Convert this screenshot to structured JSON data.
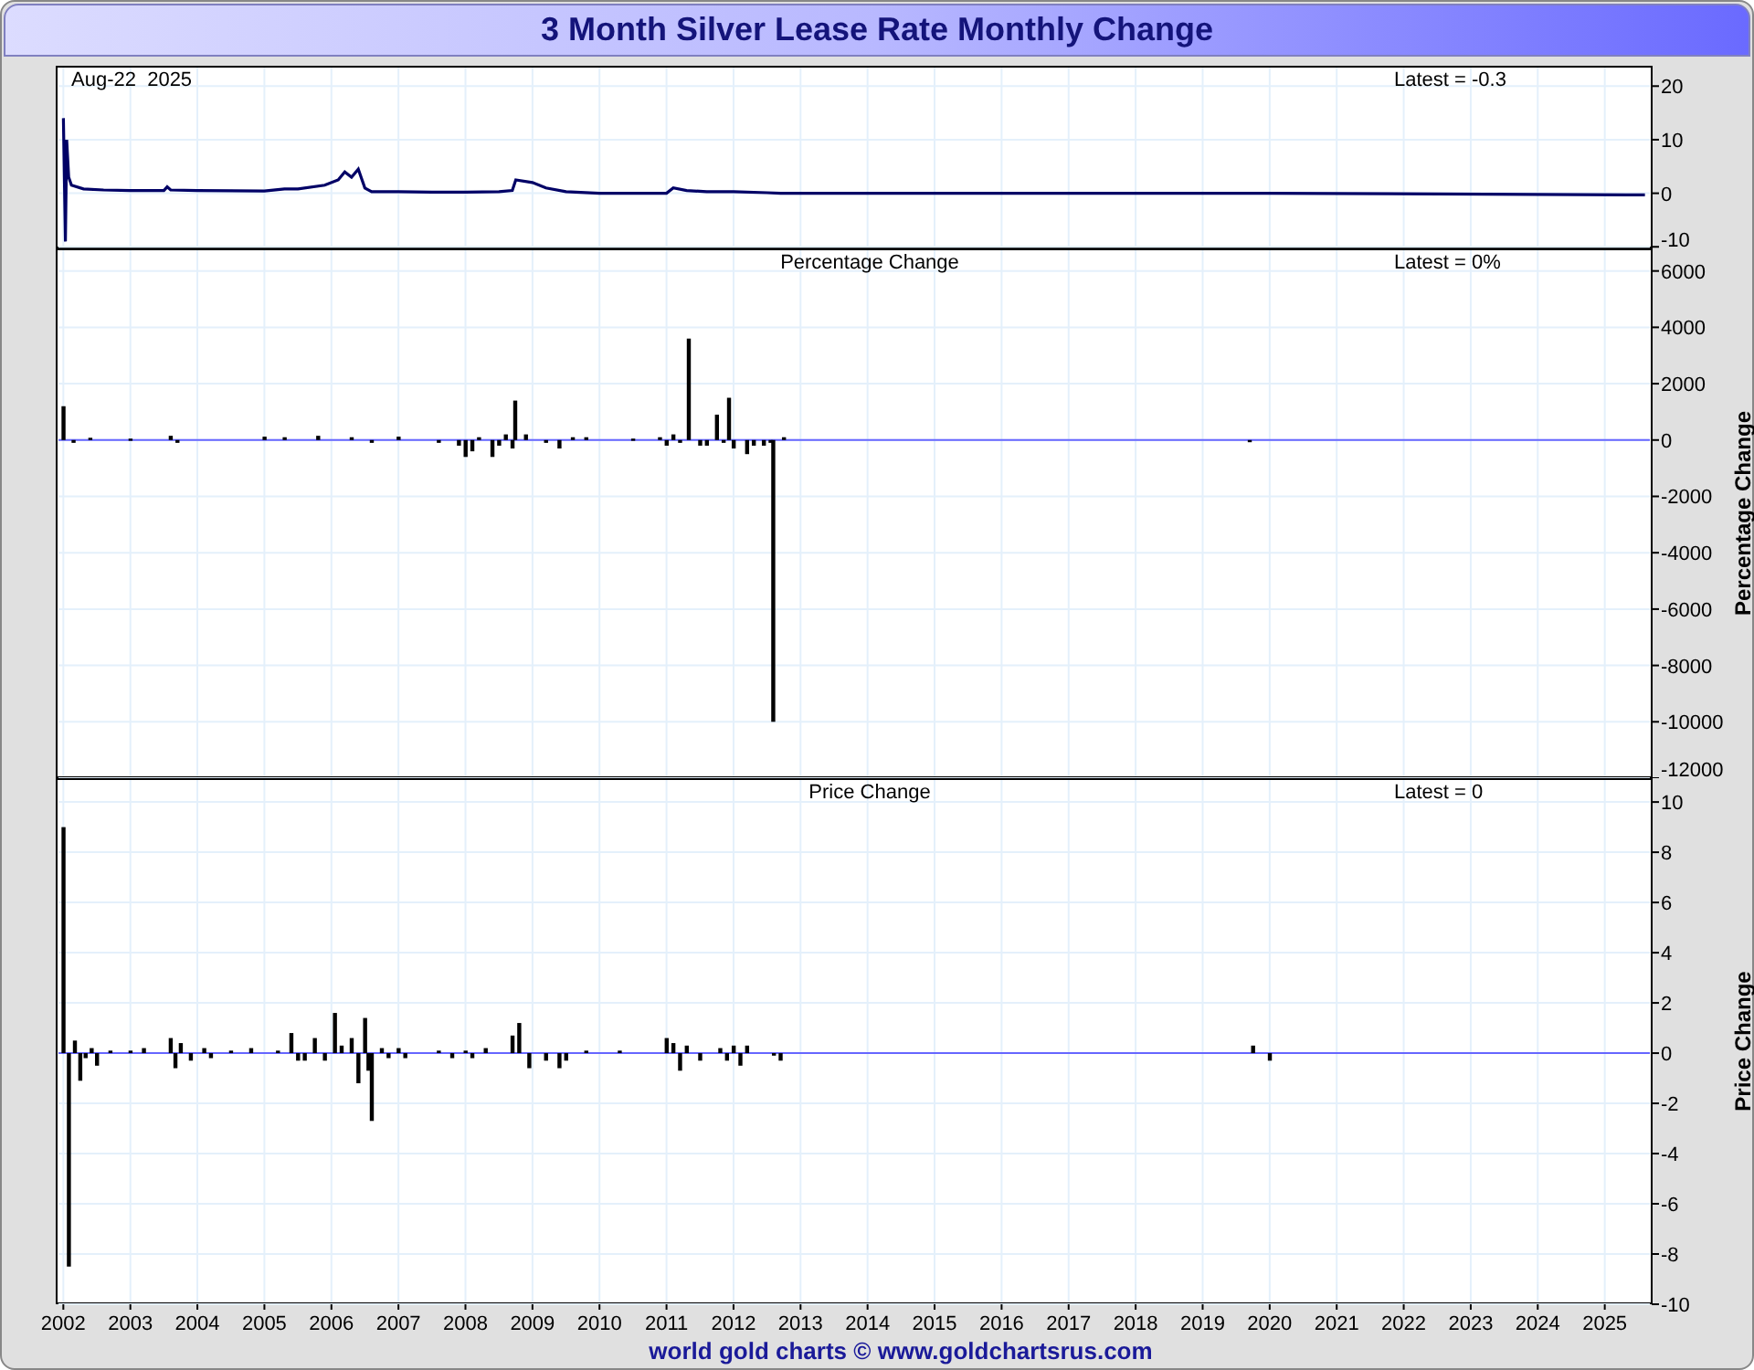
{
  "title": "3 Month Silver Lease Rate Monthly Change",
  "panels": [
    {
      "date_label": "Aug-22  2025",
      "latest": "Latest = -0.3",
      "chart_data": {
        "type": "line",
        "x": [
          2002.0,
          2002.03,
          2002.05,
          2002.08,
          2002.12,
          2002.3,
          2002.6,
          2003.0,
          2003.5,
          2003.55,
          2003.6,
          2004.0,
          2005.0,
          2005.3,
          2005.5,
          2005.9,
          2006.1,
          2006.2,
          2006.3,
          2006.4,
          2006.5,
          2006.6,
          2007.0,
          2007.5,
          2008.0,
          2008.5,
          2008.7,
          2008.75,
          2009.0,
          2009.2,
          2009.5,
          2010.0,
          2010.5,
          2011.0,
          2011.1,
          2011.3,
          2011.6,
          2012.0,
          2012.5,
          2012.7,
          2015.0,
          2020.0,
          2025.6
        ],
        "grid": true,
        "series": [
          {
            "color": "#000066",
            "values": [
              14,
              -9,
              10,
              3,
              1.5,
              0.8,
              0.6,
              0.5,
              0.5,
              1.2,
              0.6,
              0.5,
              0.4,
              0.8,
              0.8,
              1.5,
              2.5,
              4,
              3,
              4.5,
              1,
              0.3,
              0.3,
              0.2,
              0.2,
              0.3,
              0.5,
              2.5,
              2,
              1,
              0.3,
              0,
              0,
              0,
              1,
              0.5,
              0.3,
              0.3,
              0.1,
              0,
              0,
              0,
              -0.3
            ]
          }
        ],
        "xlim": [
          2001.9,
          2025.7
        ],
        "ylim": [
          -10.3,
          23.8
        ],
        "yticks": [
          -10,
          0,
          10,
          20
        ]
      }
    },
    {
      "title": "Percentage Change",
      "latest": "Latest = 0%",
      "chart_data": {
        "type": "bar",
        "ylabel": "Percentage Change",
        "x": [
          2002.0,
          2002.15,
          2002.4,
          2003.0,
          2003.6,
          2003.7,
          2005.0,
          2005.3,
          2005.8,
          2006.3,
          2006.6,
          2007.0,
          2007.6,
          2007.9,
          2008.0,
          2008.1,
          2008.2,
          2008.4,
          2008.5,
          2008.6,
          2008.7,
          2008.74,
          2008.9,
          2009.2,
          2009.4,
          2009.6,
          2009.8,
          2010.5,
          2010.9,
          2011.0,
          2011.1,
          2011.2,
          2011.33,
          2011.5,
          2011.6,
          2011.75,
          2011.85,
          2011.93,
          2012.0,
          2012.2,
          2012.3,
          2012.45,
          2012.55,
          2012.59,
          2012.75,
          2019.7
        ],
        "grid": true,
        "ref_lines": [
          {
            "axis": "y",
            "value": 0,
            "color": "#6666ff"
          }
        ],
        "series": [
          {
            "color": "#000000",
            "values": [
              1200,
              -100,
              80,
              50,
              150,
              -100,
              120,
              100,
              150,
              100,
              -100,
              120,
              -100,
              -200,
              -600,
              -400,
              100,
              -600,
              -200,
              200,
              -300,
              1400,
              200,
              -100,
              -300,
              100,
              100,
              50,
              100,
              -200,
              200,
              -100,
              3600,
              -200,
              -200,
              900,
              -100,
              1500,
              -300,
              -500,
              -200,
              -200,
              -100,
              -10000,
              100,
              -50
            ]
          }
        ],
        "xlim": [
          2001.9,
          2025.7
        ],
        "ylim": [
          -12000,
          6800
        ],
        "yticks": [
          -12000,
          -10000,
          -8000,
          -6000,
          -4000,
          -2000,
          0,
          2000,
          4000,
          6000
        ]
      }
    },
    {
      "title": "Price Change",
      "latest": "Latest = 0",
      "chart_data": {
        "type": "bar",
        "ylabel": "Price Change",
        "x": [
          2002.0,
          2002.08,
          2002.17,
          2002.25,
          2002.33,
          2002.42,
          2002.5,
          2002.7,
          2003.0,
          2003.2,
          2003.6,
          2003.67,
          2003.75,
          2003.9,
          2004.1,
          2004.2,
          2004.5,
          2004.8,
          2005.2,
          2005.4,
          2005.5,
          2005.6,
          2005.75,
          2005.9,
          2006.05,
          2006.15,
          2006.3,
          2006.4,
          2006.5,
          2006.55,
          2006.6,
          2006.75,
          2006.85,
          2007.0,
          2007.1,
          2007.6,
          2007.8,
          2008.0,
          2008.1,
          2008.3,
          2008.7,
          2008.8,
          2008.95,
          2009.2,
          2009.4,
          2009.5,
          2009.8,
          2010.3,
          2011.0,
          2011.1,
          2011.2,
          2011.3,
          2011.5,
          2011.8,
          2011.9,
          2012.0,
          2012.1,
          2012.2,
          2012.6,
          2012.7,
          2019.75,
          2020.0
        ],
        "grid": true,
        "ref_lines": [
          {
            "axis": "y",
            "value": 0,
            "color": "#6666ff"
          }
        ],
        "series": [
          {
            "color": "#000000",
            "values": [
              9,
              -8.5,
              0.5,
              -1.1,
              -0.2,
              0.2,
              -0.5,
              0.1,
              0.1,
              0.2,
              0.6,
              -0.6,
              0.4,
              -0.3,
              0.2,
              -0.2,
              0.1,
              0.2,
              0.1,
              0.8,
              -0.3,
              -0.3,
              0.6,
              -0.3,
              1.6,
              0.3,
              0.6,
              -1.2,
              1.4,
              -0.7,
              -2.7,
              0.2,
              -0.2,
              0.2,
              -0.2,
              0.1,
              -0.2,
              0.1,
              -0.2,
              0.2,
              0.7,
              1.2,
              -0.6,
              -0.3,
              -0.6,
              -0.3,
              0.1,
              0.1,
              0.6,
              0.4,
              -0.7,
              0.3,
              -0.3,
              0.2,
              -0.3,
              0.3,
              -0.5,
              0.3,
              -0.1,
              -0.3,
              0.3,
              -0.3
            ]
          }
        ],
        "xlim": [
          2001.9,
          2025.7
        ],
        "ylim": [
          -10,
          10.95
        ],
        "yticks": [
          -10,
          -8,
          -6,
          -4,
          -2,
          0,
          2,
          4,
          6,
          8,
          10
        ],
        "xticks": [
          2002,
          2003,
          2004,
          2005,
          2006,
          2007,
          2008,
          2009,
          2010,
          2011,
          2012,
          2013,
          2014,
          2015,
          2016,
          2017,
          2018,
          2019,
          2020,
          2021,
          2022,
          2023,
          2024,
          2025
        ]
      }
    }
  ],
  "footer": "world gold charts © www.goldchartsrus.com"
}
